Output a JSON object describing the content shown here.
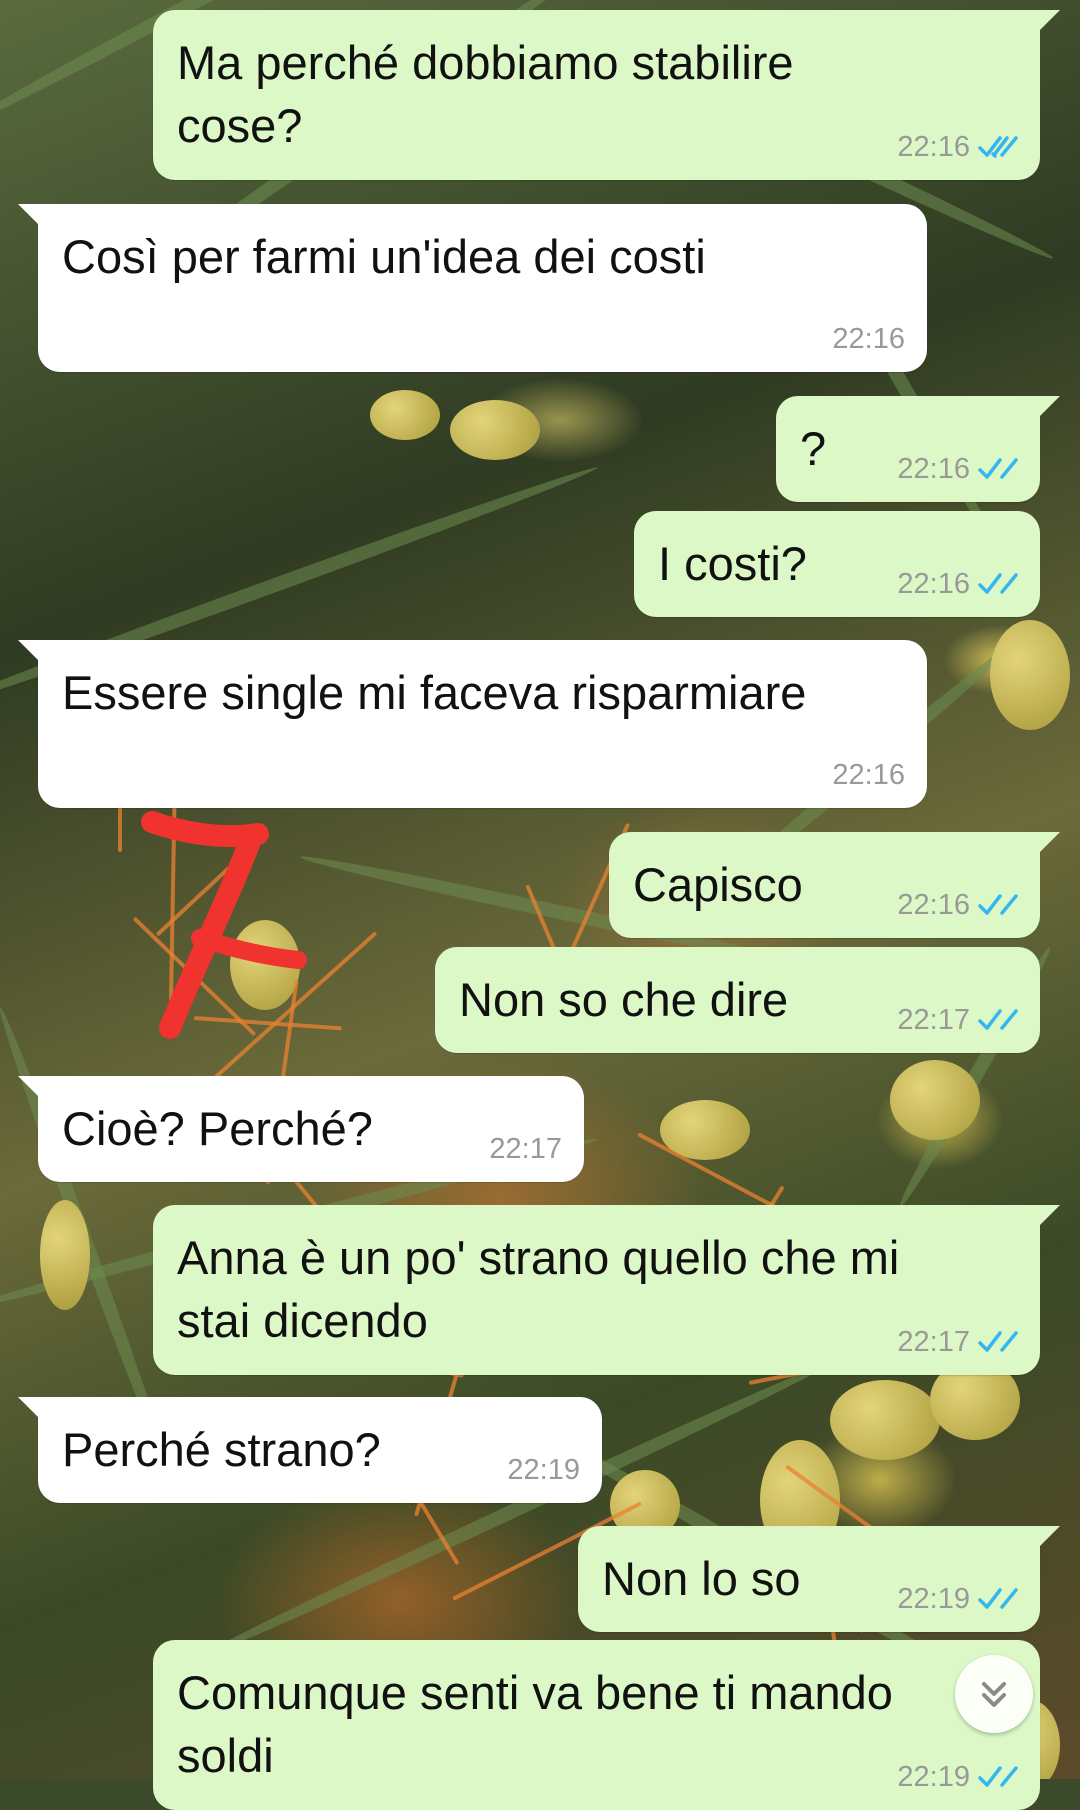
{
  "messages": [
    {
      "direction": "out",
      "text": "Ma perché dobbiamo stabilire\ncose?",
      "time": "22:16",
      "status": "read"
    },
    {
      "direction": "in",
      "text": "Così per farmi un'idea dei costi",
      "time": "22:16"
    },
    {
      "direction": "out",
      "text": "?",
      "time": "22:16",
      "status": "read"
    },
    {
      "direction": "out",
      "text": "I costi?",
      "time": "22:16",
      "status": "read"
    },
    {
      "direction": "in",
      "text": "Essere single mi faceva risparmiare",
      "time": "22:16"
    },
    {
      "direction": "out",
      "text": "Capisco",
      "time": "22:16",
      "status": "read"
    },
    {
      "direction": "out",
      "text": "Non so che dire",
      "time": "22:17",
      "status": "read"
    },
    {
      "direction": "in",
      "text": "Cioè? Perché?",
      "time": "22:17"
    },
    {
      "direction": "out",
      "text": "Anna è un po' strano quello che mi\nstai dicendo",
      "time": "22:17",
      "status": "read"
    },
    {
      "direction": "in",
      "text": "Perché strano?",
      "time": "22:19"
    },
    {
      "direction": "out",
      "text": "Non lo so",
      "time": "22:19",
      "status": "read"
    },
    {
      "direction": "out",
      "text": "Comunque senti va bene ti mando\nsoldi",
      "time": "22:19",
      "status": "read"
    }
  ],
  "annotation": {
    "mark": "red-7-scribble",
    "color": "#f0332e"
  },
  "colors": {
    "outgoing_bubble": "#dcf8c6",
    "incoming_bubble": "#ffffff",
    "read_ticks": "#34b7f1",
    "timestamp": "#999999"
  },
  "icons": {
    "read_receipt": "double-check-icon",
    "scroll_down": "double-chevron-down-icon"
  }
}
